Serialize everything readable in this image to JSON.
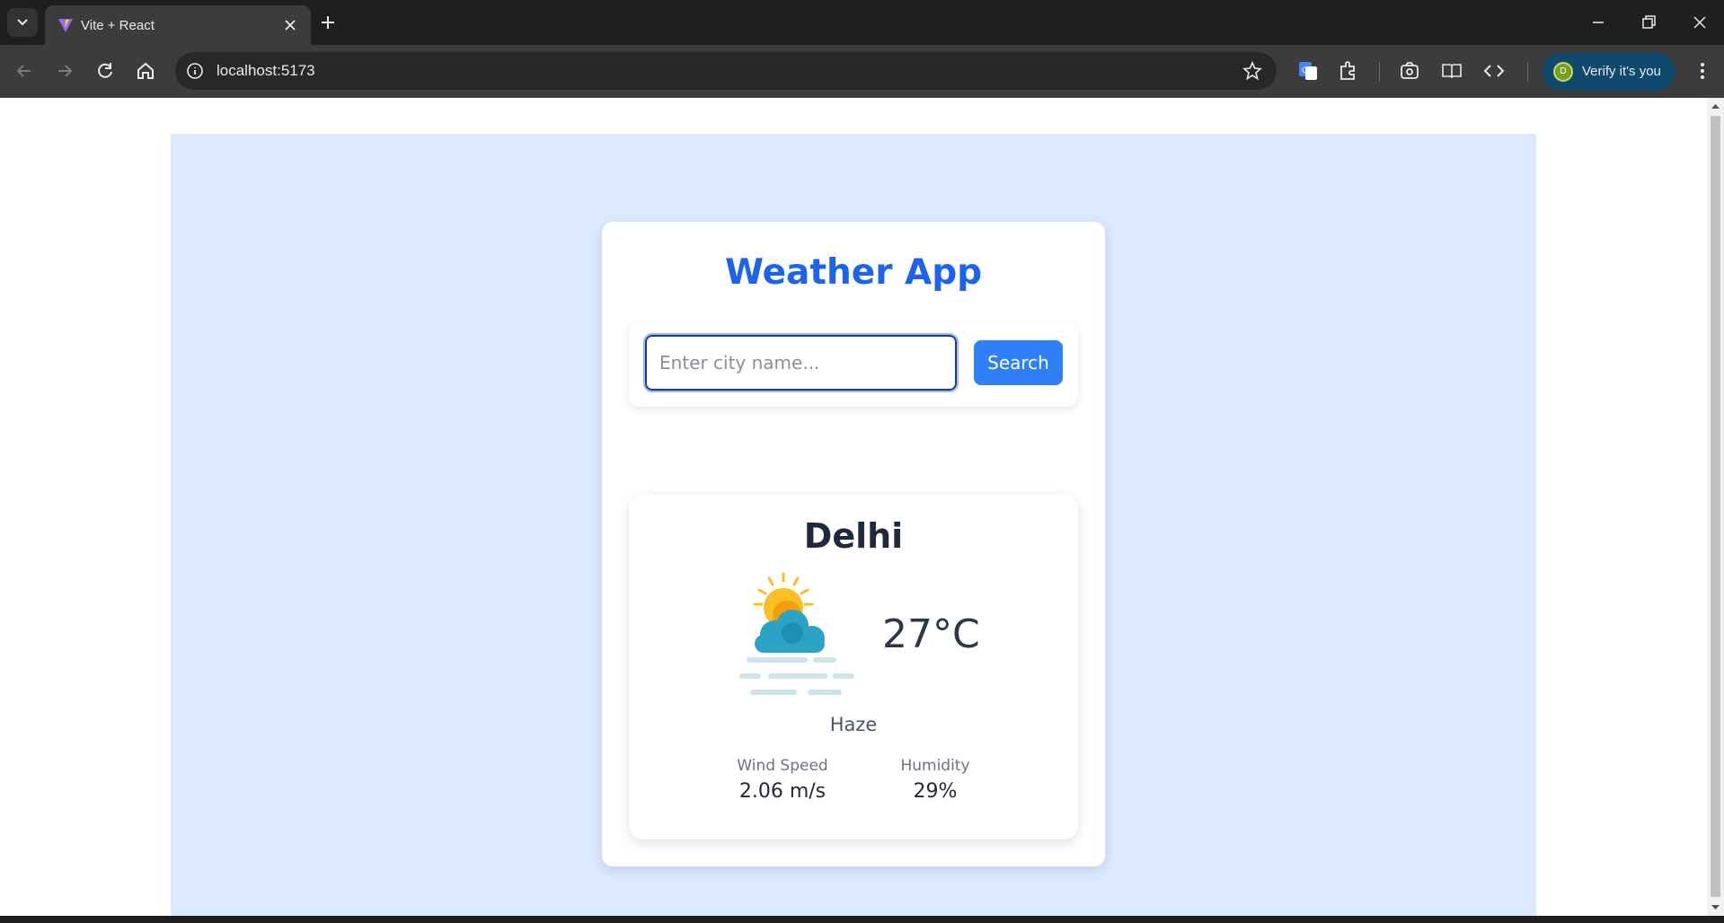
{
  "browser": {
    "tab_title": "Vite + React",
    "url": "localhost:5173",
    "profile_button": "Verify it's you",
    "profile_initial": "D"
  },
  "app": {
    "title": "Weather App",
    "search": {
      "placeholder": "Enter city name...",
      "value": "",
      "button_label": "Search"
    },
    "weather": {
      "city": "Delhi",
      "temperature": "27°C",
      "condition": "Haze",
      "icon": "haze-sun-cloud-icon",
      "wind_speed": {
        "label": "Wind Speed",
        "value": "2.06 m/s"
      },
      "humidity": {
        "label": "Humidity",
        "value": "29%"
      }
    }
  },
  "colors": {
    "title_blue": "#1d63ed",
    "button_blue": "#2f80f7",
    "page_bg": "#dbeafe"
  }
}
